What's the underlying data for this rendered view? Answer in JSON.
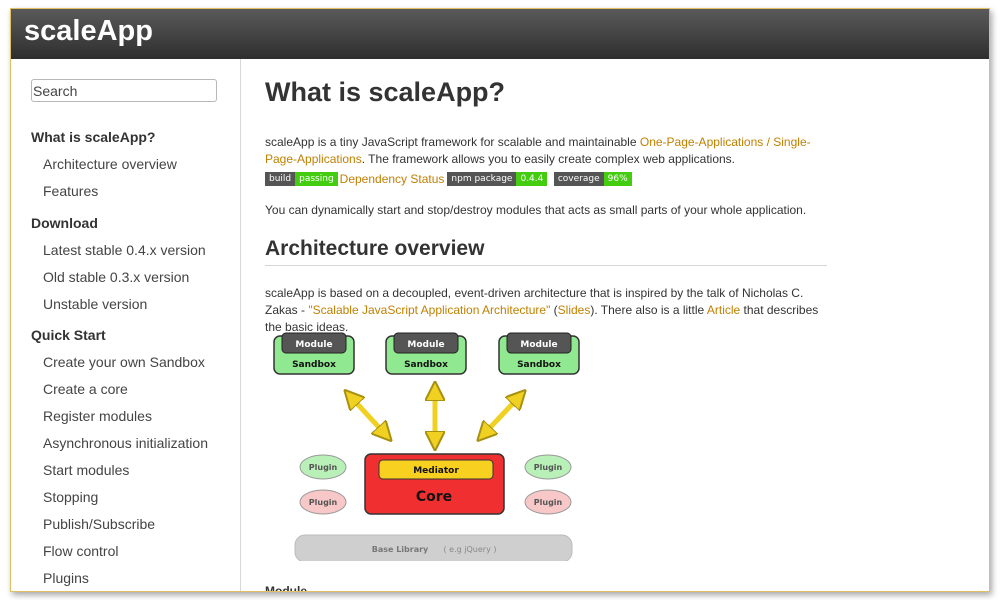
{
  "brand": "scaleApp",
  "search": {
    "placeholder": "Search"
  },
  "sidebar": {
    "sections": [
      {
        "title": "What is scaleApp?",
        "items": [
          "Architecture overview",
          "Features"
        ]
      },
      {
        "title": "Download",
        "items": [
          "Latest stable 0.4.x version",
          "Old stable 0.3.x version",
          "Unstable version"
        ]
      },
      {
        "title": "Quick Start",
        "items": [
          "Create your own Sandbox",
          "Create a core",
          "Register modules",
          "Asynchronous initialization",
          "Start modules",
          "Stopping",
          "Publish/Subscribe",
          "Flow control",
          "Plugins"
        ]
      }
    ]
  },
  "main": {
    "title": "What is scaleApp?",
    "intro": {
      "before": "scaleApp is a tiny JavaScript framework for scalable and maintainable ",
      "link": "One-Page-Applications / Single-Page-Applications",
      "after": ". The framework allows you to easily create complex web applications."
    },
    "badges": {
      "build_label": "build",
      "build_value": "passing",
      "dep_status": "Dependency Status",
      "npm_label": "npm package",
      "npm_value": "0.4.4",
      "coverage_label": "coverage",
      "coverage_value": "96%"
    },
    "dynamic_text": "You can dynamically start and stop/destroy modules that acts as small parts of your whole application.",
    "arch_title": "Architecture overview",
    "arch": {
      "before": "scaleApp is based on a decoupled, event-driven architecture that is inspired by the talk of Nicholas C. Zakas - ",
      "link1": "\"Scalable JavaScript Application Architecture\"",
      "mid1": " (",
      "link2": "Slides",
      "mid2": "). There also is a little ",
      "link3": "Article",
      "after": " that describes the basic ideas."
    },
    "diagram": {
      "module": "Module",
      "sandbox": "Sandbox",
      "plugin": "Plugin",
      "mediator": "Mediator",
      "core": "Core",
      "base_library": "Base Library",
      "base_library_note": "( e.g jQuery )"
    },
    "module_heading": "Module"
  },
  "colors": {
    "link": "#c08000",
    "sandbox_green": "#90e890",
    "core_red": "#f03030",
    "mediator_yellow": "#f8d020",
    "arrow_yellow": "#f0d020"
  }
}
